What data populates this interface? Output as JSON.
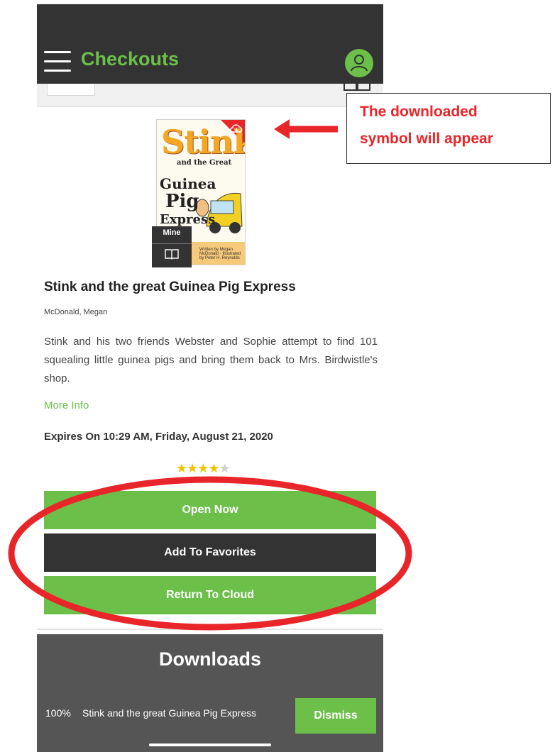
{
  "header": {
    "title": "Checkouts",
    "menu_icon": "hamburger-menu-icon",
    "account_icon": "user-avatar-icon",
    "accent_color": "#6cc04a",
    "bar_color": "#333333"
  },
  "cover": {
    "title_line1": "Stink",
    "title_line2": "and the Great",
    "title_line3": "Guinea",
    "title_line4": "Pig",
    "title_line5": "Express",
    "author_credit": "Written by Megan McDonald · Illustrated by Peter H. Reynolds",
    "download_icon": "cloud-download-icon",
    "badge_label": "Mine",
    "badge_icon": "open-book-icon"
  },
  "book": {
    "title": "Stink and the great Guinea Pig Express",
    "author": "McDonald, Megan",
    "description": "Stink and his two friends Webster and Sophie attempt to find 101 squealing little guinea pigs and bring them back to Mrs. Birdwistle's shop.",
    "more_info": "More Info",
    "expires": "Expires On 10:29 AM, Friday, August 21, 2020",
    "rating": 4,
    "rating_max": 5
  },
  "actions": {
    "open_now": "Open Now",
    "add_to_favorites": "Add To Favorites",
    "return_to_cloud": "Return To Cloud"
  },
  "downloads": {
    "title": "Downloads",
    "progress": "100%",
    "item_name": "Stink and the great Guinea Pig Express",
    "dismiss": "Dismiss"
  },
  "annotation": {
    "callout_line1": "The downloaded",
    "callout_line2": "symbol will appear",
    "annotation_color": "#e8262a"
  }
}
